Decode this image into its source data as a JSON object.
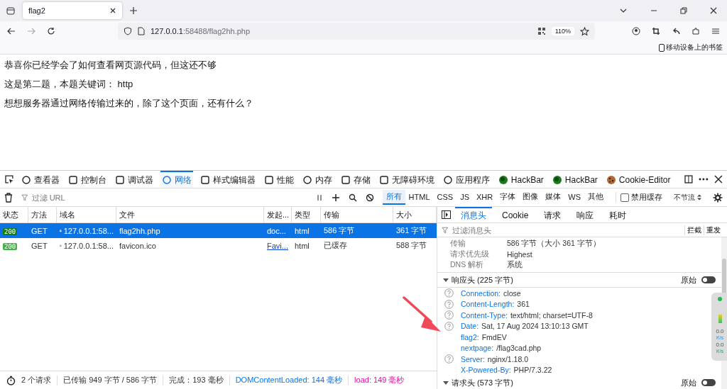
{
  "browser": {
    "tabs": [
      {
        "title": "flag2",
        "selected": true
      }
    ],
    "url_host": "127.0.0.1",
    "url_rest": ":58488/flag2hh.php",
    "zoom": "110%",
    "bookmark": "移动设备上的书签"
  },
  "page": {
    "paragraphs": [
      "恭喜你已经学会了如何查看网页源代码，但这还不够",
      "这是第二题，本题关键词： http",
      "想想服务器通过网络传输过来的，除了这个页面，还有什么？"
    ]
  },
  "devtools": {
    "tabs": [
      {
        "label": "查看器",
        "selected": false
      },
      {
        "label": "控制台",
        "selected": false
      },
      {
        "label": "调试器",
        "selected": false
      },
      {
        "label": "网络",
        "selected": true
      },
      {
        "label": "样式编辑器",
        "selected": false
      },
      {
        "label": "性能",
        "selected": false
      },
      {
        "label": "内存",
        "selected": false
      },
      {
        "label": "存储",
        "selected": false
      },
      {
        "label": "无障碍环境",
        "selected": false
      },
      {
        "label": "应用程序",
        "selected": false
      },
      {
        "label": "HackBar",
        "selected": false
      },
      {
        "label": "HackBar",
        "selected": false
      },
      {
        "label": "Cookie-Editor",
        "selected": false
      }
    ],
    "filter_placeholder": "过滤 URL",
    "type_filters": [
      {
        "label": "所有",
        "selected": true
      },
      {
        "label": "HTML",
        "selected": false
      },
      {
        "label": "CSS",
        "selected": false
      },
      {
        "label": "JS",
        "selected": false
      },
      {
        "label": "XHR",
        "selected": false
      },
      {
        "label": "字体",
        "selected": false
      },
      {
        "label": "图像",
        "selected": false
      },
      {
        "label": "媒体",
        "selected": false
      },
      {
        "label": "WS",
        "selected": false
      },
      {
        "label": "其他",
        "selected": false
      }
    ],
    "disable_cache": {
      "label": "禁用缓存",
      "checked": false
    },
    "throttle": "不节流",
    "table": {
      "columns": [
        "状态",
        "方法",
        "域名",
        "文件",
        "发起...",
        "类型",
        "传输",
        "大小"
      ],
      "rows": [
        {
          "status": "200",
          "method": "GET",
          "domain": "127.0.0.1:58...",
          "file": "flag2hh.php",
          "initiator": "doc...",
          "initiator_link": false,
          "type": "html",
          "transfer": "586 字节",
          "size": "361 字节",
          "selected": true
        },
        {
          "status": "200",
          "method": "GET",
          "domain": "127.0.0.1:58...",
          "file": "favicon.ico",
          "initiator": "Favi...",
          "initiator_link": true,
          "type": "html",
          "transfer": "已缓存",
          "size": "588 字节",
          "selected": false
        }
      ]
    },
    "details": {
      "tabs": [
        {
          "label": "消息头",
          "selected": true
        },
        {
          "label": "Cookie",
          "selected": false
        },
        {
          "label": "请求",
          "selected": false
        },
        {
          "label": "响应",
          "selected": false
        },
        {
          "label": "耗时",
          "selected": false
        }
      ],
      "filter_placeholder": "过滤消息头",
      "actions": [
        "拦截",
        "重发"
      ],
      "summary": [
        {
          "name": "传输",
          "value": "586 字节（大小 361 字节）"
        },
        {
          "name": "请求优先级",
          "value": "Highest"
        },
        {
          "name": "DNS 解析",
          "value": "系统"
        }
      ],
      "sections": [
        {
          "title": "响应头 (225 字节)",
          "raw_label": "原始",
          "raw": false,
          "expanded": true,
          "headers": [
            {
              "name": "Connection:",
              "value": "close",
              "help": true
            },
            {
              "name": "Content-Length:",
              "value": "361",
              "help": true
            },
            {
              "name": "Content-Type:",
              "value": "text/html; charset=UTF-8",
              "help": true
            },
            {
              "name": "Date:",
              "value": "Sat, 17 Aug 2024 13:10:13 GMT",
              "help": true
            },
            {
              "name": "flag2:",
              "value": "FmdEV",
              "help": false
            },
            {
              "name": "nextpage:",
              "value": "/flag3cad.php",
              "help": false
            },
            {
              "name": "Server:",
              "value": "nginx/1.18.0",
              "help": true
            },
            {
              "name": "X-Powered-By:",
              "value": "PHP/7.3.22",
              "help": false
            }
          ]
        },
        {
          "title": "请求头 (573 字节)",
          "raw_label": "原始",
          "raw": false,
          "expanded": true
        }
      ]
    },
    "status": [
      {
        "text": "2 个请求",
        "kind": "plain"
      },
      {
        "text": "已传输 949 字节 / 586 字节",
        "kind": "plain"
      },
      {
        "text": "完成：193 毫秒",
        "kind": "plain"
      },
      {
        "text": "DOMContentLoaded: 144 毫秒",
        "kind": "dom"
      },
      {
        "text": "load: 149 毫秒",
        "kind": "load"
      }
    ]
  },
  "speed_widget": {
    "readings": [
      {
        "value": "0.0",
        "unit": "K/s"
      },
      {
        "value": "0.0",
        "unit": "K/s"
      }
    ]
  }
}
